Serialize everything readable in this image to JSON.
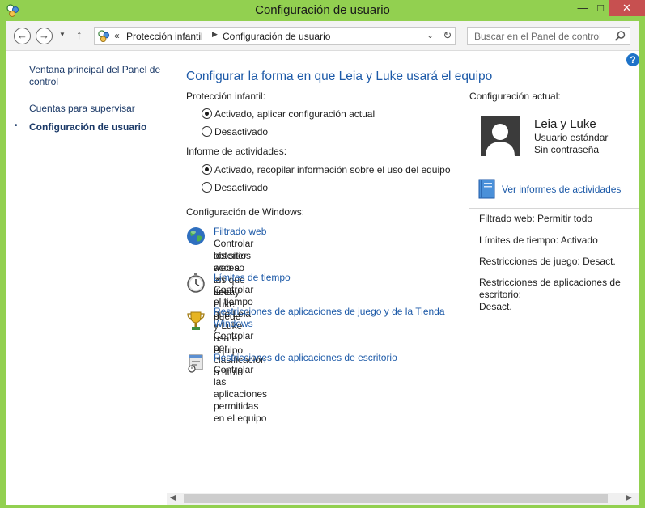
{
  "window": {
    "title": "Configuración de usuario",
    "minimize": "—",
    "maximize": "□",
    "close": "✕",
    "colors": {
      "frame": "#92d050",
      "close": "#c75050",
      "link": "#1d5aa8"
    }
  },
  "nav": {
    "back": "←",
    "forward": "→",
    "recent": "▼",
    "up": "↑",
    "breadcrumb_chevron": "«",
    "breadcrumbs": [
      "Protección infantil",
      "Configuración de usuario"
    ],
    "separator": "▶",
    "address_dropdown": "⌄",
    "refresh": "↻",
    "search_placeholder": "Buscar en el Panel de control"
  },
  "help": "?",
  "sidebar": {
    "items": [
      {
        "label": "Ventana principal del Panel de control"
      },
      {
        "label": "Cuentas para supervisar"
      },
      {
        "label": "Configuración de usuario",
        "selected": true
      }
    ],
    "bullet": "•"
  },
  "main": {
    "title": "Configurar la forma en que Leia y Luke usará el equipo",
    "parental": {
      "label": "Protección infantil:",
      "options": [
        {
          "label": "Activado, aplicar configuración actual",
          "selected": true
        },
        {
          "label": "Desactivado",
          "selected": false
        }
      ]
    },
    "activity": {
      "label": "Informe de actividades:",
      "options": [
        {
          "label": "Activado, recopilar información sobre el uso del equipo",
          "selected": true
        },
        {
          "label": "Desactivado",
          "selected": false
        }
      ]
    },
    "windows_settings": {
      "label": "Configuración de Windows:",
      "tasks": [
        {
          "icon": "globe-icon",
          "link": "Filtrado web",
          "desc": [
            "Controlar los sitios web a los que Leia y Luke puede",
            "obtener acceso en línea"
          ]
        },
        {
          "icon": "stopwatch-icon",
          "link": "Límites de tiempo",
          "desc": [
            "Controlar el tiempo que Leia y Luke usa el equipo"
          ]
        },
        {
          "icon": "trophy-icon",
          "link": [
            "Restricciones de aplicaciones de juego y de la Tienda",
            "Windows"
          ],
          "desc": [
            "Controlar por clasificación o título"
          ]
        },
        {
          "icon": "desktop-app-icon",
          "link": "Restricciones de aplicaciones de escritorio",
          "desc": [
            "Controlar las aplicaciones permitidas en el equipo"
          ]
        }
      ]
    }
  },
  "current": {
    "label": "Configuración actual:",
    "user": {
      "name": "Leia y Luke",
      "type": "Usuario estándar",
      "password": "Sin contraseña"
    },
    "report_link": "Ver informes de actividades",
    "settings": [
      {
        "text": "Filtrado web: Permitir todo"
      },
      {
        "text": "Límites de tiempo: Activado"
      },
      {
        "text": "Restricciones de juego: Desact."
      },
      {
        "lines": [
          "Restricciones de aplicaciones de",
          "escritorio:",
          "Desact."
        ]
      }
    ]
  },
  "scrollbar": {
    "left": "◀",
    "right": "▶"
  }
}
